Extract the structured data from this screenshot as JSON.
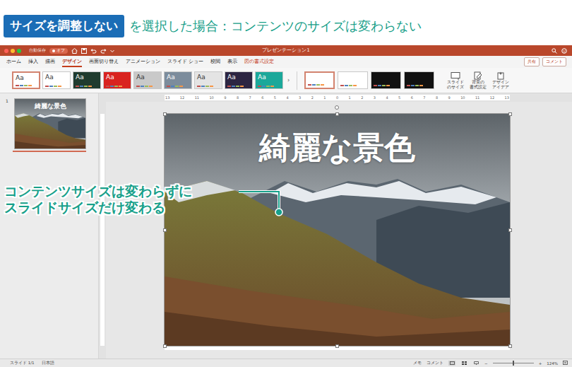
{
  "header": {
    "label": "サイズを調整しない",
    "text": "を選択した場合：コンテンツのサイズは変わらない"
  },
  "window": {
    "title": "プレゼンテーション1",
    "autosave": "自動保存",
    "autosave_state": "オフ",
    "autosave_on": false
  },
  "tabs": [
    {
      "label": "ホーム",
      "selected": false,
      "contextual": false
    },
    {
      "label": "挿入",
      "selected": false,
      "contextual": false
    },
    {
      "label": "描画",
      "selected": false,
      "contextual": false
    },
    {
      "label": "デザイン",
      "selected": true,
      "contextual": false
    },
    {
      "label": "画面切り替え",
      "selected": false,
      "contextual": false
    },
    {
      "label": "アニメーション",
      "selected": false,
      "contextual": false
    },
    {
      "label": "スライド ショー",
      "selected": false,
      "contextual": false
    },
    {
      "label": "校閲",
      "selected": false,
      "contextual": false
    },
    {
      "label": "表示",
      "selected": false,
      "contextual": false
    },
    {
      "label": "図の書式設定",
      "selected": false,
      "contextual": true
    }
  ],
  "share_button": "共有",
  "comment_button": "コメント",
  "themes": [
    {
      "label": "Aa",
      "color": "#ffffff",
      "selected": true
    },
    {
      "label": "Aa",
      "color": "#ffffff",
      "selected": false
    },
    {
      "label": "Aa",
      "color": "#1f3b2e",
      "selected": false
    },
    {
      "label": "Aa",
      "color": "#d9231f",
      "selected": false
    },
    {
      "label": "Aa",
      "color": "#c9c9c9",
      "selected": false
    },
    {
      "label": "Aa",
      "color": "#7c8c9c",
      "selected": false
    },
    {
      "label": "Aa",
      "color": "#e4e4e4",
      "selected": false
    },
    {
      "label": "Aa",
      "color": "#2c2542",
      "selected": false
    },
    {
      "label": "Aa",
      "color": "#1ba89a",
      "selected": false
    }
  ],
  "themes_more": "›",
  "variants": [
    {
      "color": "#ffffff",
      "selected": true
    },
    {
      "color": "#ffffff",
      "selected": false
    },
    {
      "color": "#111111",
      "selected": false
    },
    {
      "color": "#111111",
      "selected": false
    }
  ],
  "ribbon_buttons": [
    {
      "lines": [
        "スライド",
        "のサイズ"
      ]
    },
    {
      "lines": [
        "背景の",
        "書式設定"
      ]
    },
    {
      "lines": [
        "デザイン",
        "アイデア"
      ]
    }
  ],
  "ruler": [
    "13",
    "12",
    "11",
    "10",
    "9",
    "8",
    "7",
    "6",
    "5",
    "4",
    "3",
    "2",
    "1",
    "0",
    "1",
    "2",
    "3",
    "4",
    "5",
    "6",
    "7",
    "8",
    "9",
    "10",
    "11",
    "12",
    "13"
  ],
  "slides_panel": [
    {
      "number": "1",
      "title": "綺麗な景色",
      "selected": true
    }
  ],
  "slide": {
    "title": "綺麗な景色",
    "image_selected": true
  },
  "annotation": {
    "lines": [
      "コンテンツサイズは変わらずに",
      "スライドサイズだけ変わる"
    ]
  },
  "status_bar": {
    "slide": "スライド 1/1",
    "language": "日本語",
    "notes": "メモ",
    "comments": "コメント",
    "zoom_minus": "−",
    "zoom_plus": "+",
    "zoom": "124%",
    "zoom_level": 0.5
  }
}
